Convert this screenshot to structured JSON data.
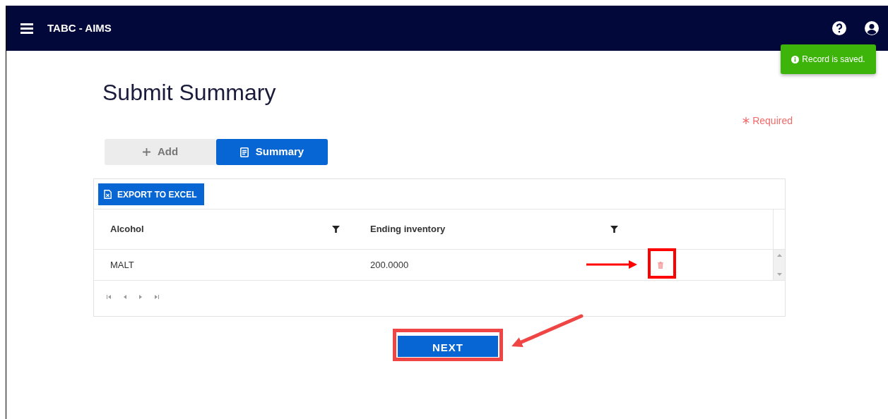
{
  "app": {
    "title": "TABC - AIMS"
  },
  "toast": {
    "message": "Record is saved."
  },
  "page": {
    "title": "Submit Summary",
    "required_note": "Required"
  },
  "tabs": [
    {
      "label": "Add",
      "selected": false
    },
    {
      "label": "Summary",
      "selected": true
    }
  ],
  "grid": {
    "export_button": "EXPORT TO EXCEL",
    "columns": [
      "Alcohol",
      "Ending inventory"
    ],
    "rows": [
      {
        "cells": [
          "MALT",
          "200.0000"
        ]
      }
    ]
  },
  "next_button": "NEXT"
}
